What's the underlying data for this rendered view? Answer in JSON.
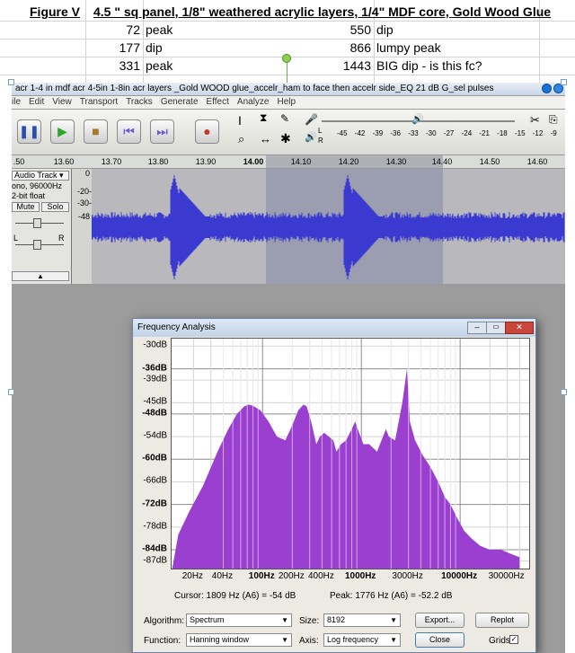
{
  "sheet": {
    "rows": [
      {
        "col_a": "Figure V",
        "col_b": "",
        "col_c": "4.5 \" sq panel, 1/8\" weathered acrylic layers, 1/4\" MDF core, Gold Wood Glue",
        "col_d": ""
      },
      {
        "col_a": "",
        "col_b": "72",
        "col_c": "peak",
        "col_d": "550",
        "col_e": "dip"
      },
      {
        "col_a": "",
        "col_b": "177",
        "col_c": "dip",
        "col_d": "866",
        "col_e": "lumpy peak"
      },
      {
        "col_a": "",
        "col_b": "331",
        "col_c": "peak",
        "col_d": "1443",
        "col_e": "BIG dip - is this fc?"
      }
    ]
  },
  "audacity": {
    "title": "acr 1-4 in mdf acr 4-5in 1-8in acr layers _Gold WOOD glue_accelr_ham to face then accelr side_EQ 21 dB G_sel pulses",
    "menus": [
      "ile",
      "Edit",
      "View",
      "Transport",
      "Tracks",
      "Generate",
      "Effect",
      "Analyze",
      "Help"
    ],
    "meter_ticks": [
      "L",
      "R",
      "-45",
      "-42",
      "-39",
      "-36",
      "-33",
      "-30",
      "-27",
      "-24",
      "-21",
      "-18",
      "-15",
      "-12",
      "-9"
    ],
    "ruler": [
      ".50",
      "13.60",
      "13.70",
      "13.80",
      "13.90",
      "14.00",
      "14.10",
      "14.20",
      "14.30",
      "14.40",
      "14.50",
      "14.60"
    ],
    "track": {
      "name": "Audio Track",
      "rate": "ono, 96000Hz",
      "format": "2-bit float",
      "mute": "Mute",
      "solo": "Solo",
      "l": "L",
      "r": "R",
      "db_ticks": [
        "0",
        "-20-",
        "-30-",
        "-48"
      ]
    }
  },
  "freq": {
    "title": "Frequency Analysis",
    "y_ticks": [
      {
        "label": "-30dB",
        "bold": false,
        "db": -30
      },
      {
        "label": "-36dB",
        "bold": true,
        "db": -36
      },
      {
        "label": "-39dB",
        "bold": false,
        "db": -39
      },
      {
        "label": "-45dB",
        "bold": false,
        "db": -45
      },
      {
        "label": "-48dB",
        "bold": true,
        "db": -48
      },
      {
        "label": "-54dB",
        "bold": false,
        "db": -54
      },
      {
        "label": "-60dB",
        "bold": true,
        "db": -60
      },
      {
        "label": "-66dB",
        "bold": false,
        "db": -66
      },
      {
        "label": "-72dB",
        "bold": true,
        "db": -72
      },
      {
        "label": "-78dB",
        "bold": false,
        "db": -78
      },
      {
        "label": "-84dB",
        "bold": true,
        "db": -84
      },
      {
        "label": "-87dB",
        "bold": false,
        "db": -87
      }
    ],
    "x_ticks": [
      {
        "label": "20Hz",
        "hz": 20,
        "bold": false
      },
      {
        "label": "40Hz",
        "hz": 40,
        "bold": false
      },
      {
        "label": "100Hz",
        "hz": 100,
        "bold": true
      },
      {
        "label": "200Hz",
        "hz": 200,
        "bold": false
      },
      {
        "label": "400Hz",
        "hz": 400,
        "bold": false
      },
      {
        "label": "1000Hz",
        "hz": 1000,
        "bold": true
      },
      {
        "label": "3000Hz",
        "hz": 3000,
        "bold": false
      },
      {
        "label": "10000Hz",
        "hz": 10000,
        "bold": true
      },
      {
        "label": "30000Hz",
        "hz": 30000,
        "bold": false
      }
    ],
    "cursor_text": "Cursor: 1809 Hz (A6) = -54 dB",
    "peak_text": "Peak: 1776 Hz (A6) = -52.2 dB",
    "algorithm_label": "Algorithm:",
    "algorithm_value": "Spectrum",
    "size_label": "Size:",
    "size_value": "8192",
    "function_label": "Function:",
    "function_value": "Hanning window",
    "axis_label": "Axis:",
    "axis_value": "Log frequency",
    "export_label": "Export...",
    "replot_label": "Replot",
    "close_label": "Close",
    "grids_label": "Grids",
    "fill_color": "#9b3fd0",
    "spectrum": [
      [
        12,
        -90
      ],
      [
        14,
        -80
      ],
      [
        18,
        -74
      ],
      [
        25,
        -67
      ],
      [
        35,
        -58
      ],
      [
        45,
        -52
      ],
      [
        55,
        -48
      ],
      [
        65,
        -46
      ],
      [
        72,
        -45.5
      ],
      [
        80,
        -45.8
      ],
      [
        95,
        -47
      ],
      [
        115,
        -50
      ],
      [
        140,
        -54
      ],
      [
        170,
        -55
      ],
      [
        200,
        -51
      ],
      [
        230,
        -47
      ],
      [
        260,
        -45.5
      ],
      [
        280,
        -46
      ],
      [
        310,
        -50
      ],
      [
        350,
        -56
      ],
      [
        380,
        -54
      ],
      [
        420,
        -53
      ],
      [
        470,
        -54
      ],
      [
        520,
        -55
      ],
      [
        560,
        -58
      ],
      [
        620,
        -56
      ],
      [
        700,
        -55
      ],
      [
        800,
        -52
      ],
      [
        866,
        -50
      ],
      [
        950,
        -53
      ],
      [
        1050,
        -56
      ],
      [
        1200,
        -56
      ],
      [
        1443,
        -58
      ],
      [
        1600,
        -55
      ],
      [
        1776,
        -52
      ],
      [
        1900,
        -54
      ],
      [
        2200,
        -55
      ],
      [
        2600,
        -45
      ],
      [
        2900,
        -36
      ],
      [
        3100,
        -50
      ],
      [
        3500,
        -55
      ],
      [
        4200,
        -59
      ],
      [
        5000,
        -62
      ],
      [
        6000,
        -66
      ],
      [
        7000,
        -70
      ],
      [
        8000,
        -72
      ],
      [
        9500,
        -76
      ],
      [
        11000,
        -79
      ],
      [
        13000,
        -81
      ],
      [
        16000,
        -83
      ],
      [
        20000,
        -84
      ],
      [
        26000,
        -84
      ],
      [
        32000,
        -85
      ],
      [
        40000,
        -86
      ]
    ]
  }
}
